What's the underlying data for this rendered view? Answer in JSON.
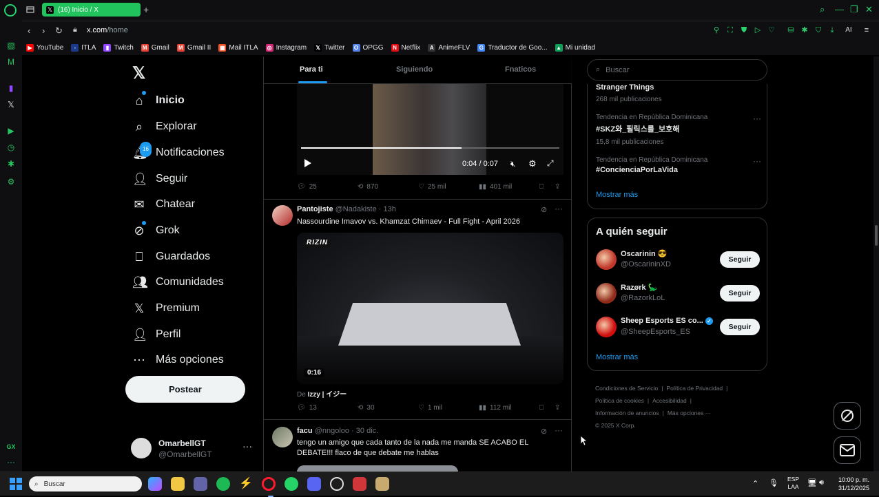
{
  "browser": {
    "tab_title": "(16) Inicio / X",
    "tab_favicon": "𝕏",
    "new_tab": "+",
    "url_host": "x.com",
    "url_path": "/home",
    "ai_label": "AI"
  },
  "bookmarks": [
    {
      "label": "YouTube",
      "icon": "youtube-icon",
      "color": "#ff0000",
      "glyph": "▶"
    },
    {
      "label": "ITLA",
      "icon": "itla-icon",
      "color": "#1b3a8a",
      "glyph": "◦"
    },
    {
      "label": "Twitch",
      "icon": "twitch-icon",
      "color": "#9146ff",
      "glyph": "▮"
    },
    {
      "label": "Gmail",
      "icon": "gmail-icon",
      "color": "#ea4335",
      "glyph": "M"
    },
    {
      "label": "Gmail II",
      "icon": "gmail-icon",
      "color": "#ea4335",
      "glyph": "M"
    },
    {
      "label": "Mail ITLA",
      "icon": "microsoft-icon",
      "color": "#f25022",
      "glyph": "▦"
    },
    {
      "label": "Instagram",
      "icon": "instagram-icon",
      "color": "#d62976",
      "glyph": "◎"
    },
    {
      "label": "Twitter",
      "icon": "x-icon",
      "color": "#000000",
      "glyph": "𝕏"
    },
    {
      "label": "OPGG",
      "icon": "opgg-icon",
      "color": "#5383e8",
      "glyph": "O"
    },
    {
      "label": "Netflix",
      "icon": "netflix-icon",
      "color": "#e50914",
      "glyph": "N"
    },
    {
      "label": "AnimeFLV",
      "icon": "animeflv-icon",
      "color": "#333333",
      "glyph": "A"
    },
    {
      "label": "Traductor de Goo...",
      "icon": "translate-icon",
      "color": "#4285f4",
      "glyph": "G"
    },
    {
      "label": "Mi unidad",
      "icon": "drive-icon",
      "color": "#0f9d58",
      "glyph": "▲"
    }
  ],
  "nav": {
    "items": [
      {
        "label": "Inicio",
        "icon": "home-icon",
        "glyph": "⌂"
      },
      {
        "label": "Explorar",
        "icon": "search-icon",
        "glyph": "⌕"
      },
      {
        "label": "Notificaciones",
        "icon": "bell-icon",
        "glyph": "🔔︎",
        "badge": "16"
      },
      {
        "label": "Seguir",
        "icon": "follow-icon",
        "glyph": "👤︎"
      },
      {
        "label": "Chatear",
        "icon": "mail-icon",
        "glyph": "✉"
      },
      {
        "label": "Grok",
        "icon": "grok-icon",
        "glyph": "⊘"
      },
      {
        "label": "Guardados",
        "icon": "bookmark-icon",
        "glyph": "⎕"
      },
      {
        "label": "Comunidades",
        "icon": "communities-icon",
        "glyph": "👥︎"
      },
      {
        "label": "Premium",
        "icon": "x-icon",
        "glyph": "𝕏"
      },
      {
        "label": "Perfil",
        "icon": "profile-icon",
        "glyph": "👤︎"
      },
      {
        "label": "Más opciones",
        "icon": "more-icon",
        "glyph": "⋯"
      }
    ],
    "post_button": "Postear",
    "account_name": "OmarbellGT",
    "account_handle": "@OmarbellGT",
    "account_more": "···"
  },
  "timeline": {
    "tabs": [
      "Para ti",
      "Siguiendo",
      "Fnaticos"
    ],
    "tweet1": {
      "video_time": "0:04 / 0:07",
      "progress": 0.62,
      "replies": "25",
      "reposts": "870",
      "likes": "25 mil",
      "views": "401 mil"
    },
    "tweet2": {
      "name": "Pantojiste",
      "handle": "@Nadakiste",
      "time": "· 13h",
      "text": "Nassourdine Imavov vs. Khamzat Chimaev - Full Fight - April 2026",
      "video_logo": "RIZIN",
      "video_duration": "0:16",
      "from_prefix": "De ",
      "from_user": "Izzy | イジー",
      "replies": "13",
      "reposts": "30",
      "likes": "1 mil",
      "views": "112 mil"
    },
    "tweet3": {
      "name": "facu",
      "handle": "@nngoloo",
      "time": "· 30 dic.",
      "text": "tengo un amigo que cada tanto de la nada me manda SE ACABO EL DEBATE!!! flaco de que debate me hablas"
    }
  },
  "right": {
    "search_placeholder": "Buscar",
    "trends": [
      {
        "name": "Stranger Things",
        "count": "268 mil publicaciones"
      },
      {
        "context": "Tendencia en República Dominicana",
        "name": "#SKZ와_필릭스를_보호해",
        "count": "15,8 mil publicaciones"
      },
      {
        "context": "Tendencia en República Dominicana",
        "name": "#ConcienciaPorLaVida"
      }
    ],
    "show_more": "Mostrar más",
    "follow_title": "A quién seguir",
    "follow": [
      {
        "name": "Oscarinin 😎",
        "handle": "@OscarininXD",
        "button": "Seguir",
        "color": "#c0392b"
      },
      {
        "name": "Razørk 🦕",
        "handle": "@RazorkLoL",
        "button": "Seguir",
        "color": "#8e2b1a"
      },
      {
        "name": "Sheep Esports ES co...",
        "handle": "@SheepEsports_ES",
        "button": "Seguir",
        "color": "#d10f0f"
      }
    ],
    "follow_more": "Mostrar más",
    "footer": [
      "Condiciones de Servicio",
      "Política de Privacidad",
      "Política de cookies",
      "Accesibilidad",
      "Información de anuncios",
      "Más opciones ···",
      "© 2025 X Corp."
    ]
  },
  "taskbar": {
    "search_placeholder": "Buscar",
    "lang_line1": "ESP",
    "lang_line2": "LAA",
    "time": "10:00 p. m.",
    "date": "31/12/2025"
  },
  "colors": {
    "accent": "#1d9bf0",
    "opera_green": "#21c35c",
    "background": "#000000"
  }
}
